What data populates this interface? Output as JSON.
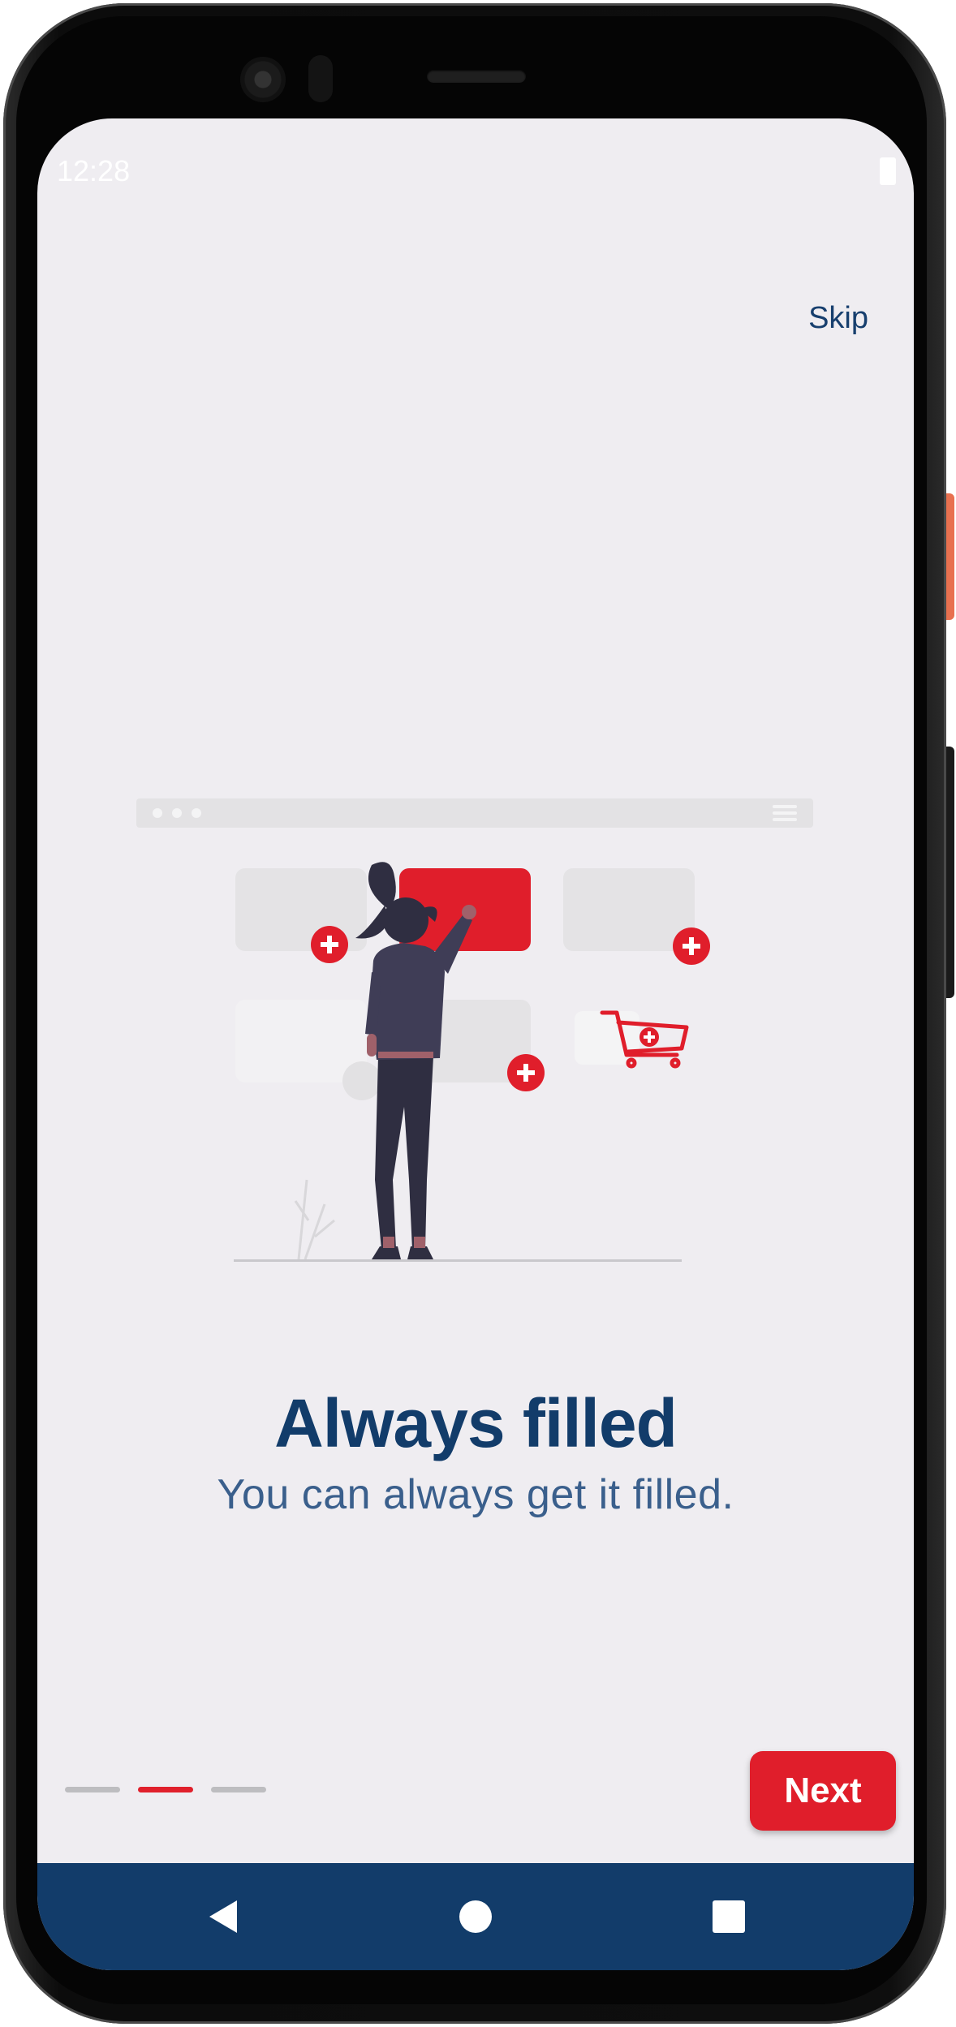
{
  "status_bar": {
    "time": "12:28"
  },
  "onboarding": {
    "skip_label": "Skip",
    "title": "Always filled",
    "subtitle": "You can always get it filled.",
    "next_label": "Next",
    "page_indicators": [
      {
        "active": false
      },
      {
        "active": true
      },
      {
        "active": false
      }
    ]
  },
  "nav_bar": {
    "back_icon": "back-triangle-icon",
    "home_icon": "home-circle-icon",
    "recents_icon": "recents-square-icon"
  },
  "colors": {
    "accent": "#e01e2b",
    "primary": "#123c6a",
    "background": "#efedf1"
  }
}
